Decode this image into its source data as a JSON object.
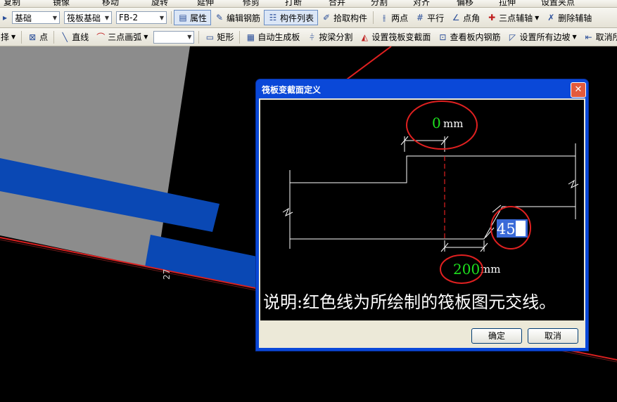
{
  "toolbar_top": {
    "items": [
      "复制",
      "镜像",
      "移动",
      "旋转",
      "延伸",
      "修剪",
      "打断",
      "合并",
      "分割",
      "对齐",
      "偏移",
      "拉伸",
      "设置夹点"
    ]
  },
  "toolbar1": {
    "combo1": "基础",
    "combo2": "筏板基础",
    "combo3": "FB-2",
    "properties": "属性",
    "edit_rebar": "编辑钢筋",
    "component_list": "构件列表",
    "pick_component": "拾取构件",
    "two_points": "两点",
    "parallel": "平行",
    "point_angle": "点角",
    "three_point_aux": "三点辅轴",
    "delete_aux": "删除辅轴"
  },
  "toolbar2": {
    "select_cut": "择",
    "point": "点",
    "line": "直线",
    "arc": "三点画弧",
    "rect": "矩形",
    "auto_slab": "自动生成板",
    "split_by_beam": "按梁分割",
    "set_section": "设置筏板变截面",
    "view_rebar": "查看板内钢筋",
    "set_edge_slope": "设置所有边坡",
    "cancel_all": "取消所有"
  },
  "canvas": {
    "axis_label": "27"
  },
  "dialog": {
    "title": "筏板变截面定义",
    "top_value": "0",
    "top_unit": "mm",
    "width_value": "200",
    "width_unit": "mm",
    "angle_value": "45",
    "note": "说明:红色线为所绘制的筏板图元交线。",
    "ok": "确定",
    "cancel": "取消"
  },
  "colors": {
    "value_green": "#1ee01e",
    "annotation_red": "#e02020",
    "selection_blue": "#3a6ad8",
    "beam_blue": "#0a48b4"
  }
}
